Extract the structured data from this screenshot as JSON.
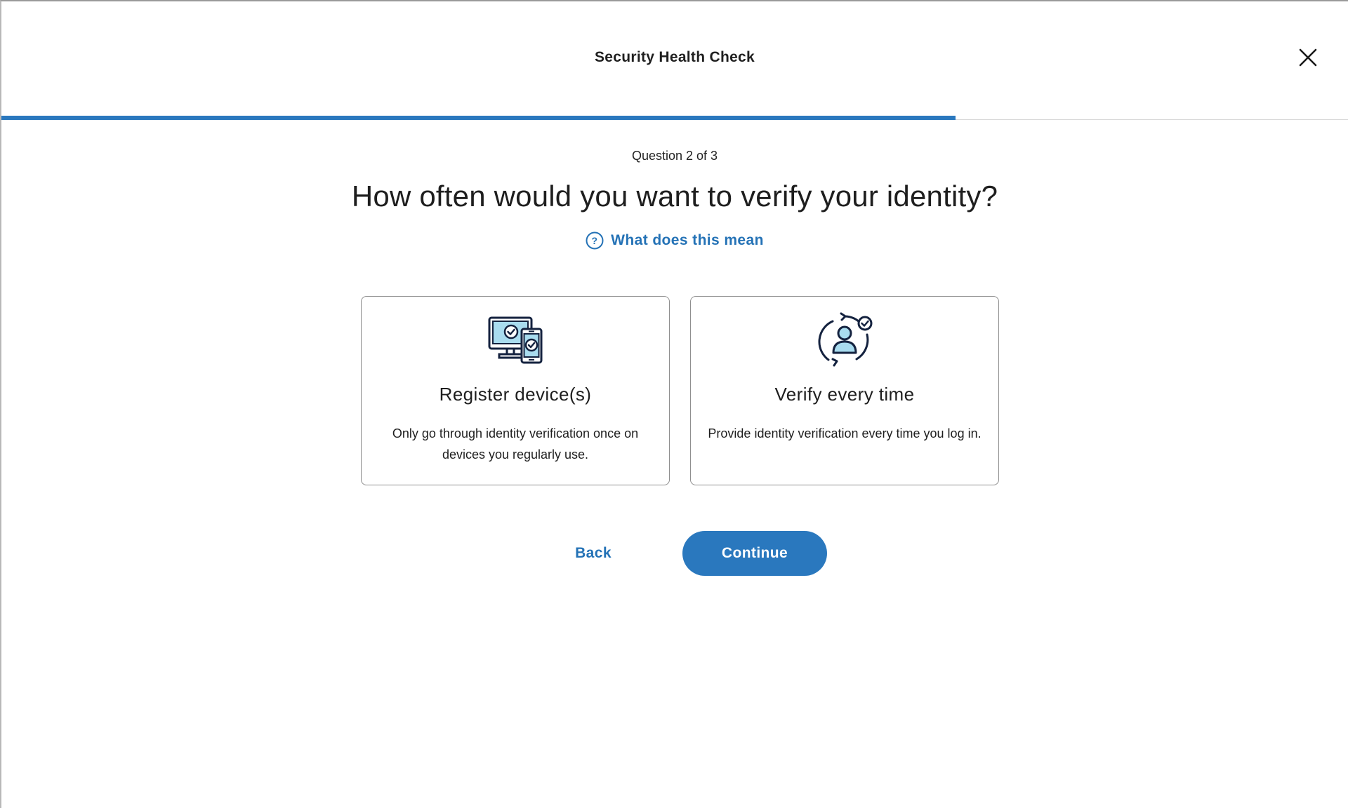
{
  "header": {
    "title": "Security Health Check",
    "close_icon": "close-icon"
  },
  "progress": {
    "fraction": 0.7083,
    "color": "#2a78be"
  },
  "question": {
    "counter": "Question 2 of 3",
    "title": "How often would you want to verify your identity?"
  },
  "help": {
    "label": "What does this mean",
    "icon": "question-circle-icon"
  },
  "options": [
    {
      "icon": "devices-check-icon",
      "title": "Register device(s)",
      "description": "Only go through identity verification once on devices you regularly use."
    },
    {
      "icon": "user-refresh-check-icon",
      "title": "Verify every time",
      "description": "Provide identity verification every time you log in."
    }
  ],
  "actions": {
    "back_label": "Back",
    "continue_label": "Continue"
  },
  "colors": {
    "accent": "#2a78be",
    "link": "#2472b6",
    "icon_fill": "#a9dcef",
    "icon_stroke": "#14223f"
  }
}
